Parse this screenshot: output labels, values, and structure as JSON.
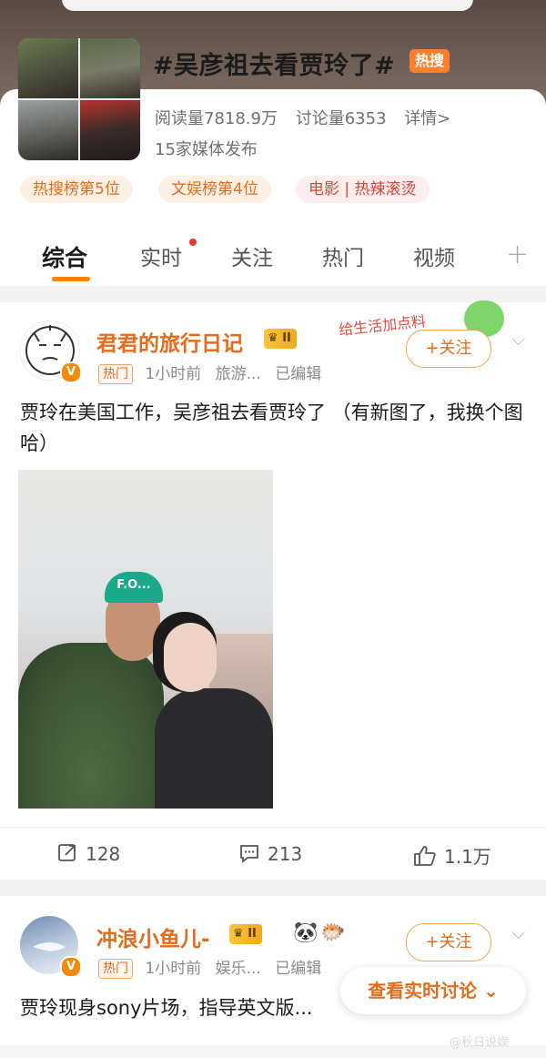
{
  "topic": {
    "title": "#吴彦祖去看贾玲了#",
    "hot_badge": "热搜",
    "read_count": "阅读量7818.9万",
    "discuss_count": "讨论量6353",
    "details_link": "详情>",
    "media": "15家媒体发布",
    "tags": [
      "热搜榜第5位",
      "文娱榜第4位",
      "电影 | 热辣滚烫"
    ]
  },
  "tabs": [
    {
      "label": "综合",
      "active": true
    },
    {
      "label": "实时",
      "active": false,
      "dot": true
    },
    {
      "label": "关注",
      "active": false
    },
    {
      "label": "热门",
      "active": false
    },
    {
      "label": "视频",
      "active": false
    }
  ],
  "tabs_more": "+",
  "posts": [
    {
      "username": "君君的旅行日记",
      "level": "II",
      "badge": "热门",
      "time": "1小时前",
      "source": "旅游...",
      "edited": "已编辑",
      "follow": "+关注",
      "decoration": "给生活加点料",
      "text": "贾玲在美国工作，吴彦祖去看贾玲了 （有新图了，我换个图哈）",
      "photo_label": "F.O...",
      "reposts": "128",
      "comments": "213",
      "likes": "1.1万"
    },
    {
      "username": "冲浪小鱼儿-",
      "level": "II",
      "badge": "热门",
      "time": "1小时前",
      "source": "娱乐...",
      "edited": "已编辑",
      "follow": "+关注",
      "text": "贾玲现身sony片场，指导英文版..."
    }
  ],
  "floating_button": "查看实时讨论",
  "watermark": "@秋日说娱",
  "colors": {
    "accent": "#e46b1a",
    "hot": "#ff7f2a",
    "tab_underline": "#ff8200"
  }
}
